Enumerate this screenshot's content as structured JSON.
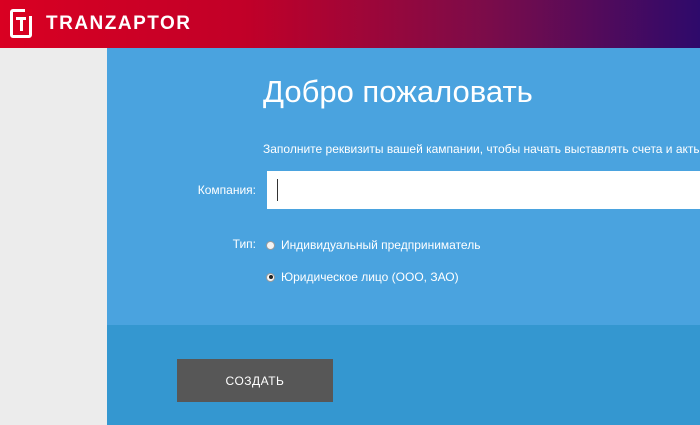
{
  "header": {
    "logo_text": "TRANZAPTOR",
    "gradient_start": "#d90022",
    "gradient_end": "#2e0a6b"
  },
  "main": {
    "title": "Добро пожаловать",
    "subtitle": "Заполните реквизиты вашей кампании, чтобы начать выставлять счета и акты",
    "company_label": "Компания:",
    "company_value": "",
    "type_label": "Тип:",
    "type_options": [
      {
        "label": "Индивидуальный предприниматель",
        "checked": false
      },
      {
        "label": "Юридическое лицо (ООО, ЗАО)",
        "checked": true
      }
    ],
    "panel_color": "#4aa3df",
    "footer_color": "#3497d0"
  },
  "actions": {
    "create_label": "СОЗДАТЬ",
    "button_color": "#575757"
  }
}
